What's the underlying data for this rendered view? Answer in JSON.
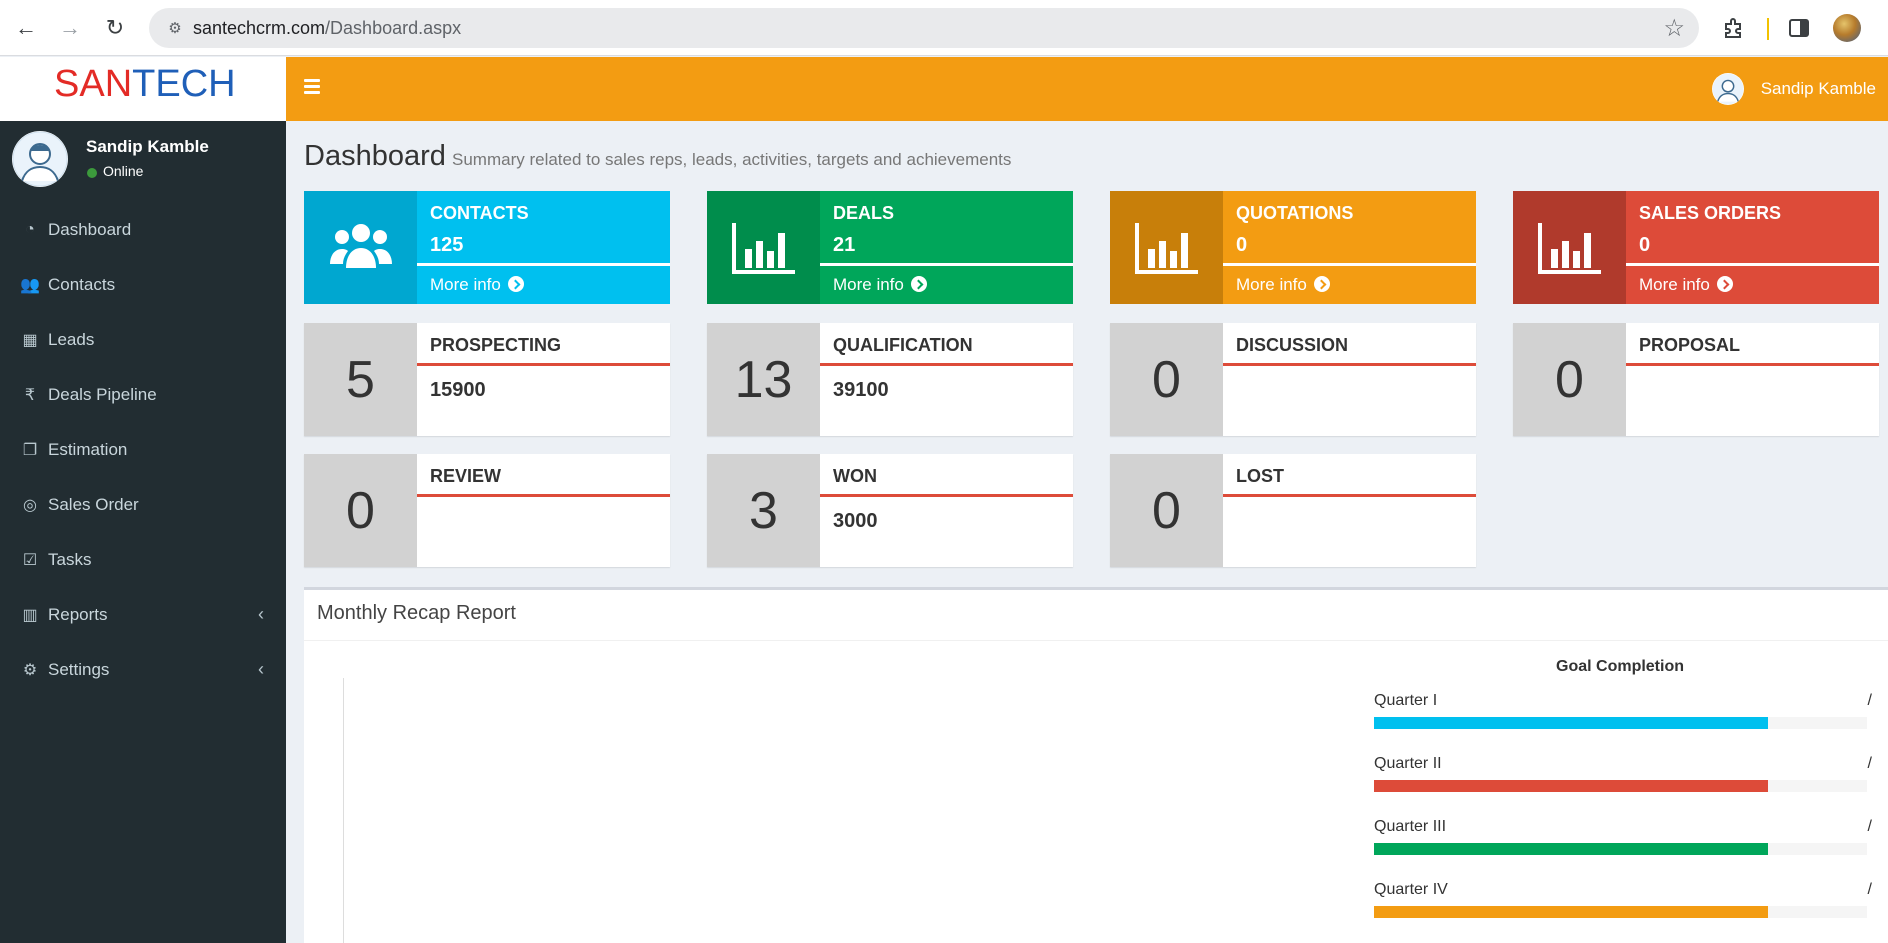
{
  "browser": {
    "url_host": "santechcrm.com",
    "url_path": "/Dashboard.aspx"
  },
  "logo": {
    "part1": "SAN",
    "part2": "TECH"
  },
  "user": {
    "name": "Sandip Kamble",
    "status": "Online"
  },
  "sidebar": {
    "items": [
      {
        "label": "Dashboard",
        "icon": "dashboard-icon",
        "glyph": "◔"
      },
      {
        "label": "Contacts",
        "icon": "users-icon",
        "glyph": "👥"
      },
      {
        "label": "Leads",
        "icon": "cubes-icon",
        "glyph": "▦"
      },
      {
        "label": "Deals Pipeline",
        "icon": "rupee-icon",
        "glyph": "₹"
      },
      {
        "label": "Estimation",
        "icon": "copy-icon",
        "glyph": "❐"
      },
      {
        "label": "Sales Order",
        "icon": "bullseye-icon",
        "glyph": "◎"
      },
      {
        "label": "Tasks",
        "icon": "check-square-icon",
        "glyph": "☑"
      },
      {
        "label": "Reports",
        "icon": "bar-chart-icon",
        "glyph": "▥",
        "chevron": "‹"
      },
      {
        "label": "Settings",
        "icon": "gear-icon",
        "glyph": "⚙",
        "chevron": "‹"
      }
    ]
  },
  "header": {
    "user_name": "Sandip Kamble"
  },
  "page": {
    "title": "Dashboard",
    "subtitle": "Summary related to sales reps, leads, activities, targets and achievements"
  },
  "info_boxes": [
    {
      "title": "CONTACTS",
      "value": "125",
      "more": "More info",
      "icon": "users-icon",
      "color_icon": "#00a7d0",
      "color_body": "#00c0ef"
    },
    {
      "title": "DEALS",
      "value": "21",
      "more": "More info",
      "icon": "bar-chart-icon",
      "color_icon": "#008d4c",
      "color_body": "#00a65a"
    },
    {
      "title": "QUOTATIONS",
      "value": "0",
      "more": "More info",
      "icon": "bar-chart-icon",
      "color_icon": "#c87f0a",
      "color_body": "#f39c12"
    },
    {
      "title": "SALES ORDERS",
      "value": "0",
      "more": "More info",
      "icon": "bar-chart-icon",
      "color_icon": "#b03a2c",
      "color_body": "#dd4b39"
    }
  ],
  "stages": [
    {
      "count": "5",
      "name": "PROSPECTING",
      "value": "15900"
    },
    {
      "count": "13",
      "name": "QUALIFICATION",
      "value": "39100"
    },
    {
      "count": "0",
      "name": "DISCUSSION",
      "value": ""
    },
    {
      "count": "0",
      "name": "PROPOSAL",
      "value": ""
    },
    {
      "count": "0",
      "name": "REVIEW",
      "value": ""
    },
    {
      "count": "3",
      "name": "WON",
      "value": "3000"
    },
    {
      "count": "0",
      "name": "LOST",
      "value": ""
    }
  ],
  "report": {
    "title": "Monthly Recap Report",
    "goal_title": "Goal Completion",
    "goals": [
      {
        "label": "Quarter I",
        "suffix": "/",
        "progress": 0.8,
        "color": "#00c0ef"
      },
      {
        "label": "Quarter II",
        "suffix": "/",
        "progress": 0.8,
        "color": "#dd4b39"
      },
      {
        "label": "Quarter III",
        "suffix": "/",
        "progress": 0.8,
        "color": "#00a65a"
      },
      {
        "label": "Quarter IV",
        "suffix": "/",
        "progress": 0.8,
        "color": "#f39c12"
      }
    ]
  },
  "colors": {
    "header": "#f39c12",
    "sidebar": "#222d32",
    "stage_line": "#dd4b39"
  }
}
